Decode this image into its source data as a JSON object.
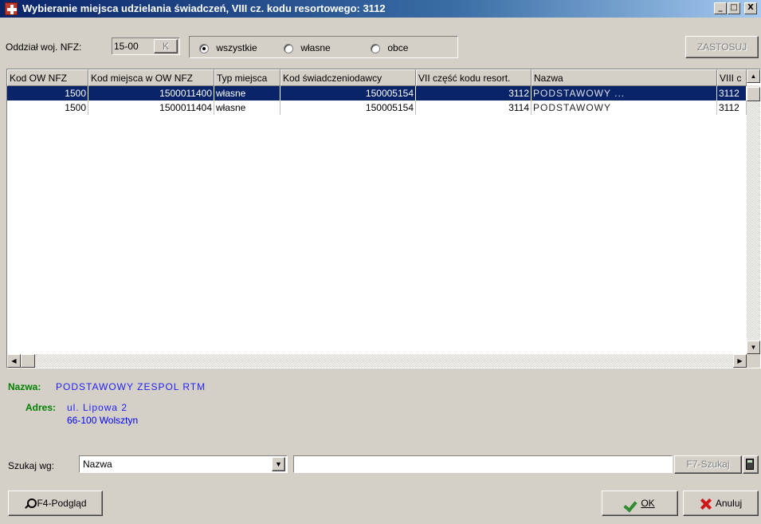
{
  "window": {
    "title": "Wybieranie miejsca udzielania świadczeń, VIII cz. kodu resortowego: 3112",
    "minimize": "_",
    "maximize": "□",
    "close": "X"
  },
  "filter": {
    "oddzial_label": "Oddział woj. NFZ:",
    "oddzial_value": "15-00",
    "k_button": "K",
    "radio_all": "wszystkie",
    "radio_own": "własne",
    "radio_other": "obce",
    "selected": "wszystkie",
    "apply_button": "ZASTOSUJ"
  },
  "table": {
    "columns": [
      "Kod OW NFZ",
      "Kod miejsca w OW NFZ",
      "Typ miejsca",
      "Kod świadczeniodawcy",
      "VII część kodu resort.",
      "Nazwa",
      "VIII c"
    ],
    "rows": [
      [
        "1500",
        "1500011400",
        "własne",
        "150005154",
        "3112",
        "PODSTAWOWY ...",
        "3112"
      ],
      [
        "1500",
        "1500011404",
        "własne",
        "150005154",
        "3114",
        "PODSTAWOWY",
        "3112"
      ]
    ],
    "selected_row": 0
  },
  "details": {
    "nazwa_label": "Nazwa:",
    "nazwa_value": "PODSTAWOWY ZESPOL RTM",
    "adres_label": "Adres:",
    "adres_line1": "ul. Lipowa 2",
    "adres_line2": "66-100 Wolsztyn"
  },
  "search": {
    "label": "Szukaj wg:",
    "field_value": "Nazwa",
    "query": "",
    "search_button": "F7-Szukaj"
  },
  "footer": {
    "preview_button": "F4-Podgląd",
    "ok_button": "OK",
    "cancel_button": "Anuluj"
  }
}
